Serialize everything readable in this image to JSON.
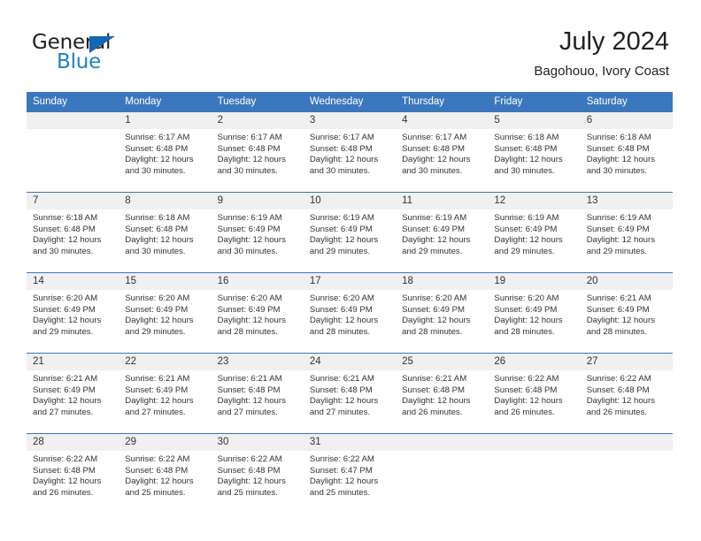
{
  "logo": {
    "general": "General",
    "blue": "Blue",
    "triangle_color": "#1567b3",
    "blue_color": "#2080c8"
  },
  "header": {
    "title": "July 2024",
    "subtitle": "Bagohouo, Ivory Coast"
  },
  "colors": {
    "header_bar": "#3b77bc",
    "daynum_band": "#f0f0f0",
    "text": "#333333"
  },
  "weekdays": [
    "Sunday",
    "Monday",
    "Tuesday",
    "Wednesday",
    "Thursday",
    "Friday",
    "Saturday"
  ],
  "weeks": [
    [
      {
        "day": "",
        "sunrise": "",
        "sunset": "",
        "daylight1": "",
        "daylight2": ""
      },
      {
        "day": "1",
        "sunrise": "Sunrise: 6:17 AM",
        "sunset": "Sunset: 6:48 PM",
        "daylight1": "Daylight: 12 hours",
        "daylight2": "and 30 minutes."
      },
      {
        "day": "2",
        "sunrise": "Sunrise: 6:17 AM",
        "sunset": "Sunset: 6:48 PM",
        "daylight1": "Daylight: 12 hours",
        "daylight2": "and 30 minutes."
      },
      {
        "day": "3",
        "sunrise": "Sunrise: 6:17 AM",
        "sunset": "Sunset: 6:48 PM",
        "daylight1": "Daylight: 12 hours",
        "daylight2": "and 30 minutes."
      },
      {
        "day": "4",
        "sunrise": "Sunrise: 6:17 AM",
        "sunset": "Sunset: 6:48 PM",
        "daylight1": "Daylight: 12 hours",
        "daylight2": "and 30 minutes."
      },
      {
        "day": "5",
        "sunrise": "Sunrise: 6:18 AM",
        "sunset": "Sunset: 6:48 PM",
        "daylight1": "Daylight: 12 hours",
        "daylight2": "and 30 minutes."
      },
      {
        "day": "6",
        "sunrise": "Sunrise: 6:18 AM",
        "sunset": "Sunset: 6:48 PM",
        "daylight1": "Daylight: 12 hours",
        "daylight2": "and 30 minutes."
      }
    ],
    [
      {
        "day": "7",
        "sunrise": "Sunrise: 6:18 AM",
        "sunset": "Sunset: 6:48 PM",
        "daylight1": "Daylight: 12 hours",
        "daylight2": "and 30 minutes."
      },
      {
        "day": "8",
        "sunrise": "Sunrise: 6:18 AM",
        "sunset": "Sunset: 6:48 PM",
        "daylight1": "Daylight: 12 hours",
        "daylight2": "and 30 minutes."
      },
      {
        "day": "9",
        "sunrise": "Sunrise: 6:19 AM",
        "sunset": "Sunset: 6:49 PM",
        "daylight1": "Daylight: 12 hours",
        "daylight2": "and 30 minutes."
      },
      {
        "day": "10",
        "sunrise": "Sunrise: 6:19 AM",
        "sunset": "Sunset: 6:49 PM",
        "daylight1": "Daylight: 12 hours",
        "daylight2": "and 29 minutes."
      },
      {
        "day": "11",
        "sunrise": "Sunrise: 6:19 AM",
        "sunset": "Sunset: 6:49 PM",
        "daylight1": "Daylight: 12 hours",
        "daylight2": "and 29 minutes."
      },
      {
        "day": "12",
        "sunrise": "Sunrise: 6:19 AM",
        "sunset": "Sunset: 6:49 PM",
        "daylight1": "Daylight: 12 hours",
        "daylight2": "and 29 minutes."
      },
      {
        "day": "13",
        "sunrise": "Sunrise: 6:19 AM",
        "sunset": "Sunset: 6:49 PM",
        "daylight1": "Daylight: 12 hours",
        "daylight2": "and 29 minutes."
      }
    ],
    [
      {
        "day": "14",
        "sunrise": "Sunrise: 6:20 AM",
        "sunset": "Sunset: 6:49 PM",
        "daylight1": "Daylight: 12 hours",
        "daylight2": "and 29 minutes."
      },
      {
        "day": "15",
        "sunrise": "Sunrise: 6:20 AM",
        "sunset": "Sunset: 6:49 PM",
        "daylight1": "Daylight: 12 hours",
        "daylight2": "and 29 minutes."
      },
      {
        "day": "16",
        "sunrise": "Sunrise: 6:20 AM",
        "sunset": "Sunset: 6:49 PM",
        "daylight1": "Daylight: 12 hours",
        "daylight2": "and 28 minutes."
      },
      {
        "day": "17",
        "sunrise": "Sunrise: 6:20 AM",
        "sunset": "Sunset: 6:49 PM",
        "daylight1": "Daylight: 12 hours",
        "daylight2": "and 28 minutes."
      },
      {
        "day": "18",
        "sunrise": "Sunrise: 6:20 AM",
        "sunset": "Sunset: 6:49 PM",
        "daylight1": "Daylight: 12 hours",
        "daylight2": "and 28 minutes."
      },
      {
        "day": "19",
        "sunrise": "Sunrise: 6:20 AM",
        "sunset": "Sunset: 6:49 PM",
        "daylight1": "Daylight: 12 hours",
        "daylight2": "and 28 minutes."
      },
      {
        "day": "20",
        "sunrise": "Sunrise: 6:21 AM",
        "sunset": "Sunset: 6:49 PM",
        "daylight1": "Daylight: 12 hours",
        "daylight2": "and 28 minutes."
      }
    ],
    [
      {
        "day": "21",
        "sunrise": "Sunrise: 6:21 AM",
        "sunset": "Sunset: 6:49 PM",
        "daylight1": "Daylight: 12 hours",
        "daylight2": "and 27 minutes."
      },
      {
        "day": "22",
        "sunrise": "Sunrise: 6:21 AM",
        "sunset": "Sunset: 6:49 PM",
        "daylight1": "Daylight: 12 hours",
        "daylight2": "and 27 minutes."
      },
      {
        "day": "23",
        "sunrise": "Sunrise: 6:21 AM",
        "sunset": "Sunset: 6:48 PM",
        "daylight1": "Daylight: 12 hours",
        "daylight2": "and 27 minutes."
      },
      {
        "day": "24",
        "sunrise": "Sunrise: 6:21 AM",
        "sunset": "Sunset: 6:48 PM",
        "daylight1": "Daylight: 12 hours",
        "daylight2": "and 27 minutes."
      },
      {
        "day": "25",
        "sunrise": "Sunrise: 6:21 AM",
        "sunset": "Sunset: 6:48 PM",
        "daylight1": "Daylight: 12 hours",
        "daylight2": "and 26 minutes."
      },
      {
        "day": "26",
        "sunrise": "Sunrise: 6:22 AM",
        "sunset": "Sunset: 6:48 PM",
        "daylight1": "Daylight: 12 hours",
        "daylight2": "and 26 minutes."
      },
      {
        "day": "27",
        "sunrise": "Sunrise: 6:22 AM",
        "sunset": "Sunset: 6:48 PM",
        "daylight1": "Daylight: 12 hours",
        "daylight2": "and 26 minutes."
      }
    ],
    [
      {
        "day": "28",
        "sunrise": "Sunrise: 6:22 AM",
        "sunset": "Sunset: 6:48 PM",
        "daylight1": "Daylight: 12 hours",
        "daylight2": "and 26 minutes."
      },
      {
        "day": "29",
        "sunrise": "Sunrise: 6:22 AM",
        "sunset": "Sunset: 6:48 PM",
        "daylight1": "Daylight: 12 hours",
        "daylight2": "and 25 minutes."
      },
      {
        "day": "30",
        "sunrise": "Sunrise: 6:22 AM",
        "sunset": "Sunset: 6:48 PM",
        "daylight1": "Daylight: 12 hours",
        "daylight2": "and 25 minutes."
      },
      {
        "day": "31",
        "sunrise": "Sunrise: 6:22 AM",
        "sunset": "Sunset: 6:47 PM",
        "daylight1": "Daylight: 12 hours",
        "daylight2": "and 25 minutes."
      },
      {
        "day": "",
        "sunrise": "",
        "sunset": "",
        "daylight1": "",
        "daylight2": ""
      },
      {
        "day": "",
        "sunrise": "",
        "sunset": "",
        "daylight1": "",
        "daylight2": ""
      },
      {
        "day": "",
        "sunrise": "",
        "sunset": "",
        "daylight1": "",
        "daylight2": ""
      }
    ]
  ]
}
